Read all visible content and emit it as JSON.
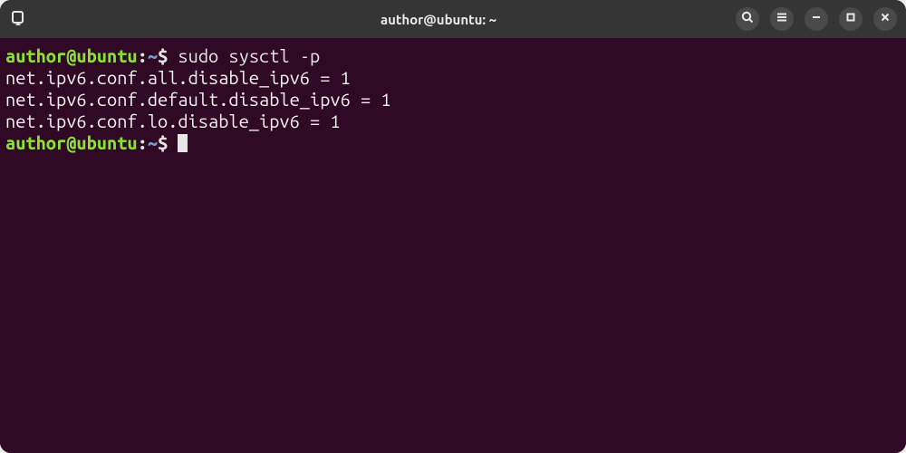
{
  "titlebar": {
    "title": "author@ubuntu: ~"
  },
  "prompt": {
    "user_host": "author@ubuntu",
    "separator": ":",
    "path": "~",
    "symbol": "$"
  },
  "session": {
    "command": "sudo sysctl -p",
    "output": [
      "net.ipv6.conf.all.disable_ipv6 = 1",
      "net.ipv6.conf.default.disable_ipv6 = 1",
      "net.ipv6.conf.lo.disable_ipv6 = 1"
    ]
  },
  "icons": {
    "new_tab": "new-tab-icon",
    "search": "search-icon",
    "menu": "hamburger-icon",
    "minimize": "minimize-icon",
    "maximize": "maximize-icon",
    "close": "close-icon"
  }
}
